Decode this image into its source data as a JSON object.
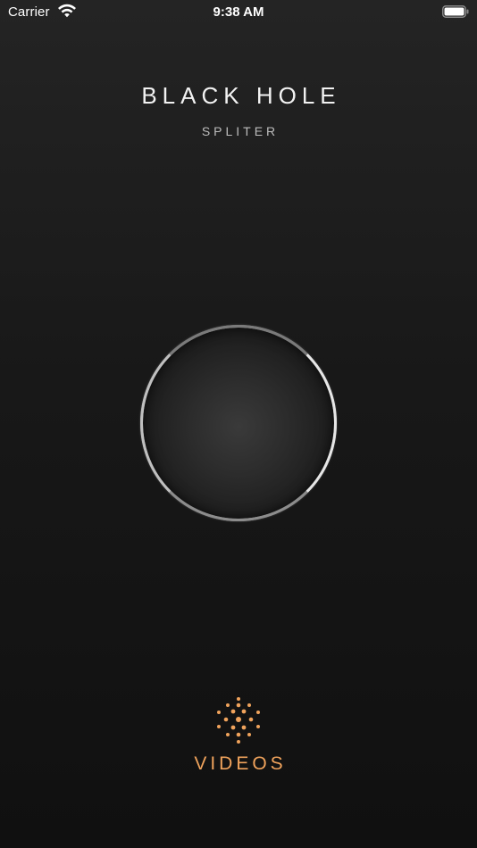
{
  "status_bar": {
    "carrier": "Carrier",
    "time": "9:38 AM",
    "wifi_icon": "wifi-icon",
    "battery_icon": "battery-icon"
  },
  "header": {
    "title": "BLACK HOLE",
    "subtitle": "SPLITER"
  },
  "main": {
    "orb_icon": "black-hole-orb"
  },
  "footer": {
    "videos_icon": "dots-burst-icon",
    "videos_label": "VIDEOS"
  },
  "colors": {
    "accent": "#f0a35c",
    "background_top": "#242424",
    "background_bottom": "#101010",
    "text_primary": "#f2f2f2",
    "text_secondary": "#bdbdbd"
  }
}
